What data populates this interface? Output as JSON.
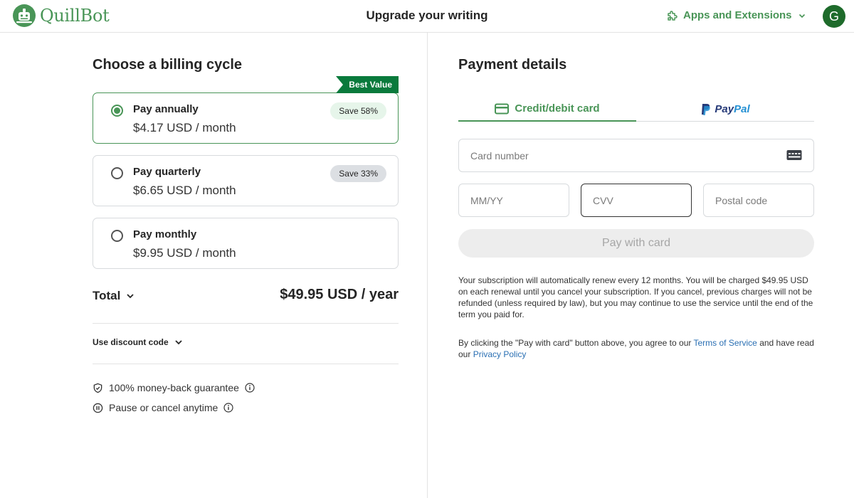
{
  "header": {
    "brand": "QuillBot",
    "title": "Upgrade your writing",
    "apps_label": "Apps and Extensions",
    "avatar_initial": "G"
  },
  "billing": {
    "title": "Choose a billing cycle",
    "best_value": "Best Value",
    "plans": [
      {
        "name": "Pay annually",
        "price": "$4.17 USD / month",
        "badge": "Save 58%",
        "selected": true
      },
      {
        "name": "Pay quarterly",
        "price": "$6.65 USD / month",
        "badge": "Save 33%",
        "selected": false
      },
      {
        "name": "Pay monthly",
        "price": "$9.95 USD / month",
        "badge": "",
        "selected": false
      }
    ],
    "total_label": "Total",
    "total_value": "$49.95 USD / year",
    "discount_label": "Use discount code",
    "guarantees": [
      {
        "text": "100% money-back guarantee"
      },
      {
        "text": "Pause or cancel anytime"
      }
    ]
  },
  "payment": {
    "title": "Payment details",
    "tabs": {
      "card": "Credit/debit card",
      "paypal_a": "Pay",
      "paypal_b": "Pal"
    },
    "fields": {
      "card_number": "Card number",
      "expiry": "MM/YY",
      "cvv": "CVV",
      "postal": "Postal code"
    },
    "pay_button": "Pay with card",
    "renewal_notice": "Your subscription will automatically renew every 12 months. You will be charged $49.95 USD on each renewal until you cancel your subscription. If you cancel, previous charges will not be refunded (unless required by law), but you may continue to use the service until the end of the term you paid for.",
    "agree_prefix": "By clicking the \"Pay with card\" button above, you agree to our ",
    "terms_link": "Terms of Service",
    "agree_middle": " and have read our ",
    "privacy_link": "Privacy Policy"
  },
  "colors": {
    "brand_green": "#499557",
    "best_value_bg": "#0a7a3c",
    "link": "#2a6fb3"
  }
}
